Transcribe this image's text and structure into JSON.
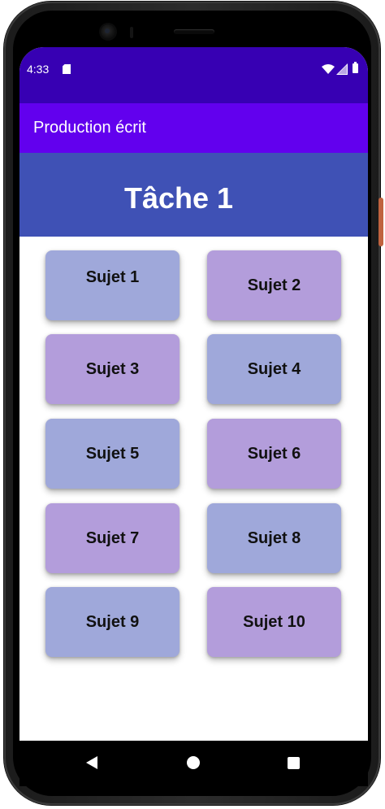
{
  "status_bar": {
    "time": "4:33",
    "color": "#3700b3"
  },
  "app_bar": {
    "title": "Production écrit",
    "color": "#6200ee"
  },
  "header": {
    "title": "Tâche 1",
    "color": "#3f51b5"
  },
  "tiles": [
    {
      "label": "Sujet 1",
      "color": "#9fa8da"
    },
    {
      "label": "Sujet 2",
      "color": "#b39ddb"
    },
    {
      "label": "Sujet 3",
      "color": "#b39ddb"
    },
    {
      "label": "Sujet 4",
      "color": "#9fa8da"
    },
    {
      "label": "Sujet 5",
      "color": "#9fa8da"
    },
    {
      "label": "Sujet 6",
      "color": "#b39ddb"
    },
    {
      "label": "Sujet 7",
      "color": "#b39ddb"
    },
    {
      "label": "Sujet 8",
      "color": "#9fa8da"
    },
    {
      "label": "Sujet 9",
      "color": "#9fa8da"
    },
    {
      "label": "Sujet 10",
      "color": "#b39ddb"
    }
  ],
  "nav_bar": {
    "icons": [
      "back-icon",
      "home-icon",
      "recents-icon"
    ]
  }
}
